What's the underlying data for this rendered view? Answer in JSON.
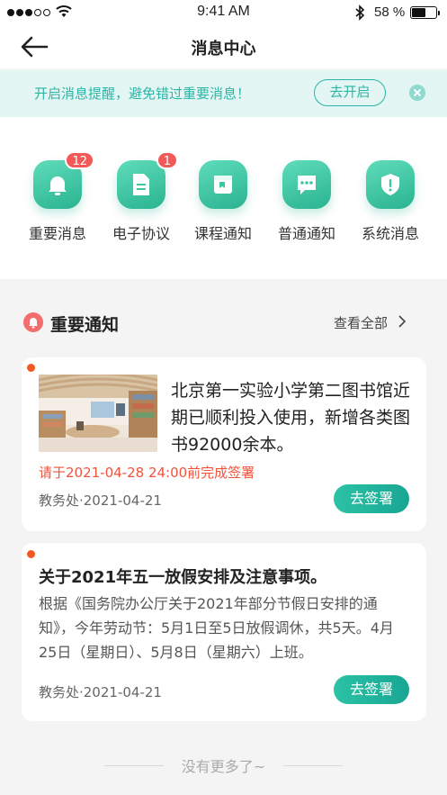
{
  "status_bar": {
    "time": "9:41 AM",
    "battery_percent": "58 %",
    "battery_level": 0.58
  },
  "nav": {
    "title": "消息中心"
  },
  "notice": {
    "text": "开启消息提醒，避免错过重要消息！",
    "button": "去开启"
  },
  "categories": [
    {
      "label": "重要消息",
      "icon": "bell-icon",
      "badge": "12"
    },
    {
      "label": "电子协议",
      "icon": "document-icon",
      "badge": "1"
    },
    {
      "label": "课程通知",
      "icon": "book-icon"
    },
    {
      "label": "普通通知",
      "icon": "chat-bubble-icon"
    },
    {
      "label": "系统消息",
      "icon": "shield-alert-icon"
    }
  ],
  "section": {
    "title": "重要通知",
    "see_all": "查看全部"
  },
  "notifications": [
    {
      "title": "北京第一实验小学第二图书馆近期已顺利投入使用，新增各类图书92000余本。",
      "deadline": "请于2021-04-28  24:00前完成签署",
      "meta": "教务处·2021-04-21",
      "button": "去签署",
      "unread": true
    },
    {
      "title": "关于2021年五一放假安排及注意事项。",
      "body": "根据《国务院办公厅关于2021年部分节假日安排的通知》，今年劳动节：5月1日至5日放假调休，共5天。4月25日（星期日）、5月8日（星期六）上班。",
      "meta": "教务处·2021-04-21",
      "button": "去签署",
      "unread": true
    }
  ],
  "footer": {
    "end_text": "没有更多了~"
  },
  "colors": {
    "accent": "#2bb5a7",
    "icon_green": "#3cc8a0",
    "badge_red": "#f25a5a",
    "deadline_red": "#f0533c",
    "unread_dot": "#f25822"
  }
}
